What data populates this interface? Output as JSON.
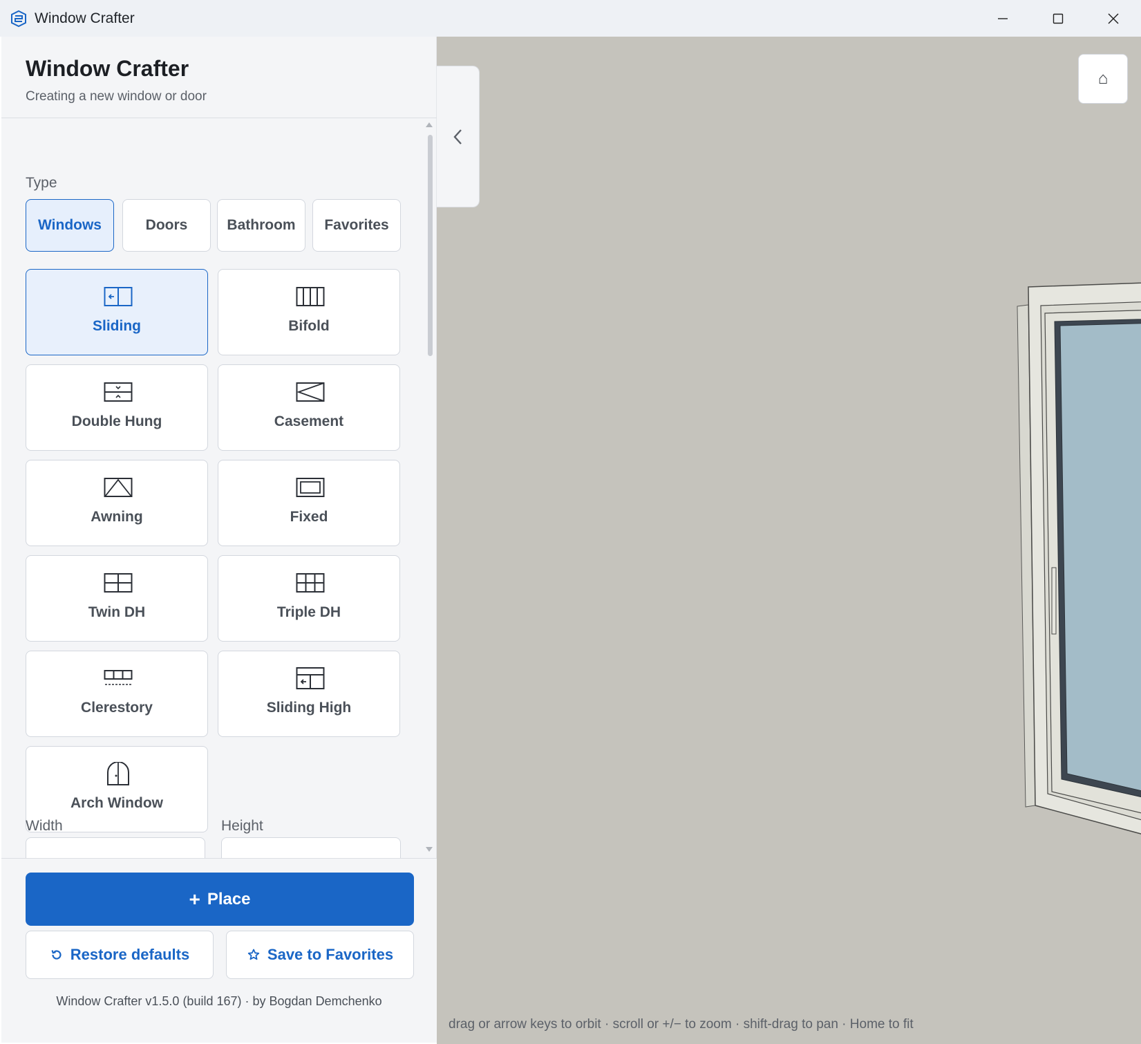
{
  "window": {
    "title": "Window Crafter"
  },
  "panel": {
    "title": "Window Crafter",
    "subtitle": "Creating a new window or door",
    "type_label": "Type",
    "types": [
      {
        "label": "Windows",
        "active": true
      },
      {
        "label": "Doors",
        "active": false
      },
      {
        "label": "Bathroom",
        "active": false
      },
      {
        "label": "Favorites",
        "active": false
      }
    ],
    "styles": [
      {
        "label": "Sliding",
        "icon": "sliding-icon",
        "active": true
      },
      {
        "label": "Bifold",
        "icon": "bifold-icon",
        "active": false
      },
      {
        "label": "Double Hung",
        "icon": "double-hung-icon",
        "active": false
      },
      {
        "label": "Casement",
        "icon": "casement-icon",
        "active": false
      },
      {
        "label": "Awning",
        "icon": "awning-icon",
        "active": false
      },
      {
        "label": "Fixed",
        "icon": "fixed-icon",
        "active": false
      },
      {
        "label": "Twin DH",
        "icon": "twin-dh-icon",
        "active": false
      },
      {
        "label": "Triple DH",
        "icon": "triple-dh-icon",
        "active": false
      },
      {
        "label": "Clerestory",
        "icon": "clerestory-icon",
        "active": false
      },
      {
        "label": "Sliding High",
        "icon": "sliding-high-icon",
        "active": false
      },
      {
        "label": "Arch Window",
        "icon": "arch-window-icon",
        "active": false
      }
    ],
    "width_label": "Width",
    "height_label": "Height"
  },
  "footer": {
    "place_label": "Place",
    "restore_label": "Restore defaults",
    "favorites_label": "Save to Favorites",
    "version_text": "Window Crafter v1.5.0 (build 167) · by Bogdan Demchenko"
  },
  "viewport": {
    "home_glyph": "⌂",
    "hint": "drag or arrow keys to orbit · scroll or +/− to zoom · shift-drag to pan · Home to fit"
  },
  "colors": {
    "accent": "#1a66c6",
    "glass": "#a3bcc8",
    "frame": "#e6e6df",
    "viewport_bg": "#c5c3bc"
  }
}
